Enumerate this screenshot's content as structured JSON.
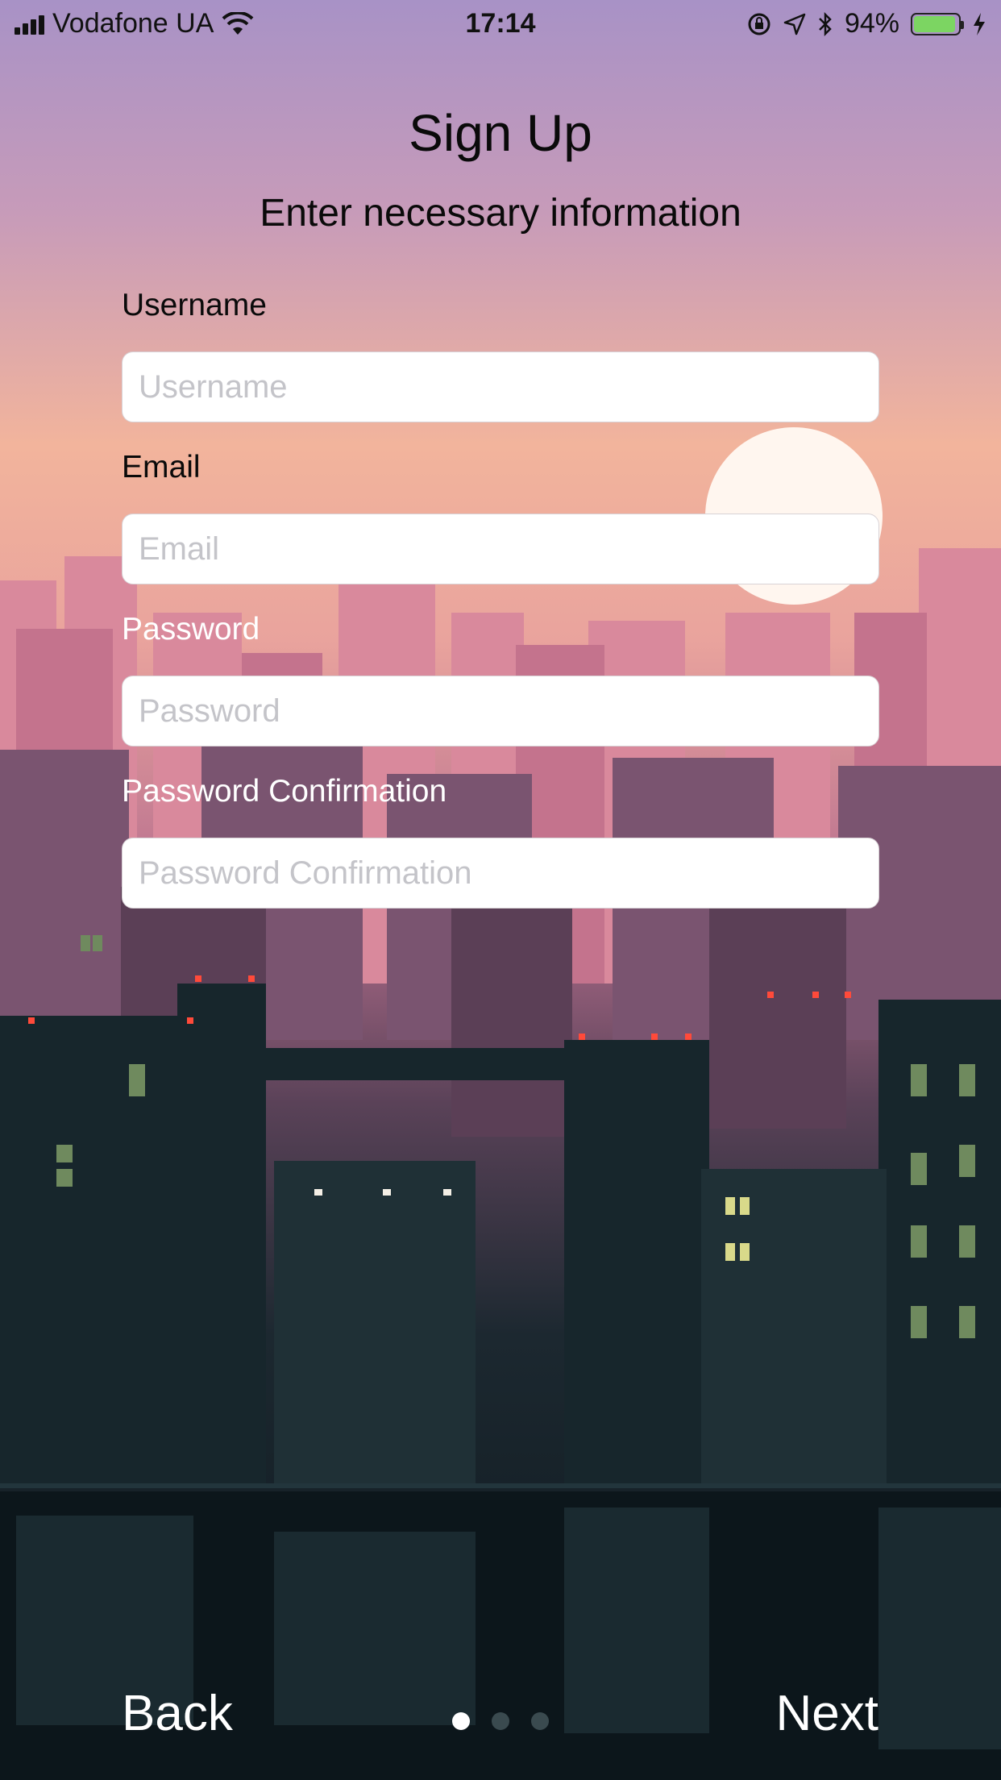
{
  "status_bar": {
    "carrier": "Vodafone UA",
    "time": "17:14",
    "battery_percent": "94%",
    "battery_level": 0.94,
    "icons": [
      "signal-icon",
      "wifi-icon",
      "orientation-lock-icon",
      "location-icon",
      "bluetooth-icon",
      "battery-icon",
      "charging-icon"
    ]
  },
  "header": {
    "title": "Sign Up",
    "subtitle": "Enter necessary information"
  },
  "form": {
    "fields": [
      {
        "label": "Username",
        "placeholder": "Username",
        "value": ""
      },
      {
        "label": "Email",
        "placeholder": "Email",
        "value": ""
      },
      {
        "label": "Password",
        "placeholder": "Password",
        "value": ""
      },
      {
        "label": "Password Confirmation",
        "placeholder": "Password Confirmation",
        "value": ""
      }
    ]
  },
  "navigation": {
    "back_label": "Back",
    "next_label": "Next",
    "page_count": 3,
    "current_page": 1
  },
  "colors": {
    "sky_top": "#a892c6",
    "sky_mid": "#f2b49c",
    "city_pink": "#c97a95",
    "night_dark": "#0f1a1f",
    "battery_green": "#7cd562"
  }
}
